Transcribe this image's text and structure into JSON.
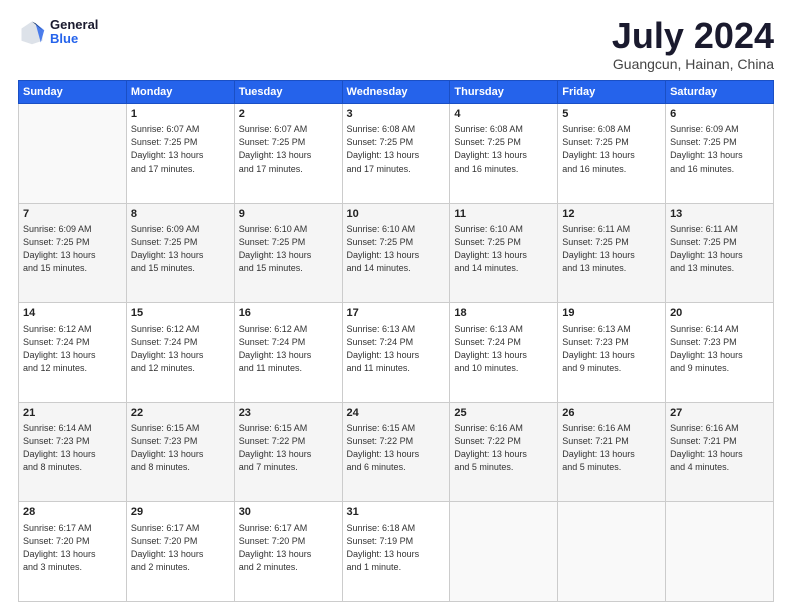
{
  "header": {
    "logo_line1": "General",
    "logo_line2": "Blue",
    "title": "July 2024",
    "location": "Guangcun, Hainan, China"
  },
  "days_of_week": [
    "Sunday",
    "Monday",
    "Tuesday",
    "Wednesday",
    "Thursday",
    "Friday",
    "Saturday"
  ],
  "weeks": [
    [
      {
        "day": "",
        "info": ""
      },
      {
        "day": "1",
        "info": "Sunrise: 6:07 AM\nSunset: 7:25 PM\nDaylight: 13 hours\nand 17 minutes."
      },
      {
        "day": "2",
        "info": "Sunrise: 6:07 AM\nSunset: 7:25 PM\nDaylight: 13 hours\nand 17 minutes."
      },
      {
        "day": "3",
        "info": "Sunrise: 6:08 AM\nSunset: 7:25 PM\nDaylight: 13 hours\nand 17 minutes."
      },
      {
        "day": "4",
        "info": "Sunrise: 6:08 AM\nSunset: 7:25 PM\nDaylight: 13 hours\nand 16 minutes."
      },
      {
        "day": "5",
        "info": "Sunrise: 6:08 AM\nSunset: 7:25 PM\nDaylight: 13 hours\nand 16 minutes."
      },
      {
        "day": "6",
        "info": "Sunrise: 6:09 AM\nSunset: 7:25 PM\nDaylight: 13 hours\nand 16 minutes."
      }
    ],
    [
      {
        "day": "7",
        "info": "Sunrise: 6:09 AM\nSunset: 7:25 PM\nDaylight: 13 hours\nand 15 minutes."
      },
      {
        "day": "8",
        "info": "Sunrise: 6:09 AM\nSunset: 7:25 PM\nDaylight: 13 hours\nand 15 minutes."
      },
      {
        "day": "9",
        "info": "Sunrise: 6:10 AM\nSunset: 7:25 PM\nDaylight: 13 hours\nand 15 minutes."
      },
      {
        "day": "10",
        "info": "Sunrise: 6:10 AM\nSunset: 7:25 PM\nDaylight: 13 hours\nand 14 minutes."
      },
      {
        "day": "11",
        "info": "Sunrise: 6:10 AM\nSunset: 7:25 PM\nDaylight: 13 hours\nand 14 minutes."
      },
      {
        "day": "12",
        "info": "Sunrise: 6:11 AM\nSunset: 7:25 PM\nDaylight: 13 hours\nand 13 minutes."
      },
      {
        "day": "13",
        "info": "Sunrise: 6:11 AM\nSunset: 7:25 PM\nDaylight: 13 hours\nand 13 minutes."
      }
    ],
    [
      {
        "day": "14",
        "info": "Sunrise: 6:12 AM\nSunset: 7:24 PM\nDaylight: 13 hours\nand 12 minutes."
      },
      {
        "day": "15",
        "info": "Sunrise: 6:12 AM\nSunset: 7:24 PM\nDaylight: 13 hours\nand 12 minutes."
      },
      {
        "day": "16",
        "info": "Sunrise: 6:12 AM\nSunset: 7:24 PM\nDaylight: 13 hours\nand 11 minutes."
      },
      {
        "day": "17",
        "info": "Sunrise: 6:13 AM\nSunset: 7:24 PM\nDaylight: 13 hours\nand 11 minutes."
      },
      {
        "day": "18",
        "info": "Sunrise: 6:13 AM\nSunset: 7:24 PM\nDaylight: 13 hours\nand 10 minutes."
      },
      {
        "day": "19",
        "info": "Sunrise: 6:13 AM\nSunset: 7:23 PM\nDaylight: 13 hours\nand 9 minutes."
      },
      {
        "day": "20",
        "info": "Sunrise: 6:14 AM\nSunset: 7:23 PM\nDaylight: 13 hours\nand 9 minutes."
      }
    ],
    [
      {
        "day": "21",
        "info": "Sunrise: 6:14 AM\nSunset: 7:23 PM\nDaylight: 13 hours\nand 8 minutes."
      },
      {
        "day": "22",
        "info": "Sunrise: 6:15 AM\nSunset: 7:23 PM\nDaylight: 13 hours\nand 8 minutes."
      },
      {
        "day": "23",
        "info": "Sunrise: 6:15 AM\nSunset: 7:22 PM\nDaylight: 13 hours\nand 7 minutes."
      },
      {
        "day": "24",
        "info": "Sunrise: 6:15 AM\nSunset: 7:22 PM\nDaylight: 13 hours\nand 6 minutes."
      },
      {
        "day": "25",
        "info": "Sunrise: 6:16 AM\nSunset: 7:22 PM\nDaylight: 13 hours\nand 5 minutes."
      },
      {
        "day": "26",
        "info": "Sunrise: 6:16 AM\nSunset: 7:21 PM\nDaylight: 13 hours\nand 5 minutes."
      },
      {
        "day": "27",
        "info": "Sunrise: 6:16 AM\nSunset: 7:21 PM\nDaylight: 13 hours\nand 4 minutes."
      }
    ],
    [
      {
        "day": "28",
        "info": "Sunrise: 6:17 AM\nSunset: 7:20 PM\nDaylight: 13 hours\nand 3 minutes."
      },
      {
        "day": "29",
        "info": "Sunrise: 6:17 AM\nSunset: 7:20 PM\nDaylight: 13 hours\nand 2 minutes."
      },
      {
        "day": "30",
        "info": "Sunrise: 6:17 AM\nSunset: 7:20 PM\nDaylight: 13 hours\nand 2 minutes."
      },
      {
        "day": "31",
        "info": "Sunrise: 6:18 AM\nSunset: 7:19 PM\nDaylight: 13 hours\nand 1 minute."
      },
      {
        "day": "",
        "info": ""
      },
      {
        "day": "",
        "info": ""
      },
      {
        "day": "",
        "info": ""
      }
    ]
  ]
}
